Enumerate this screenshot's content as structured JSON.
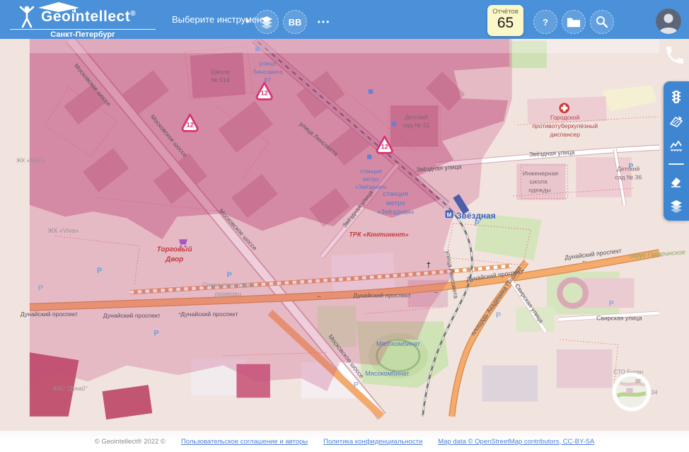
{
  "header": {
    "brand": "Geointellect",
    "brand_reg": "®",
    "city": "Санкт-Петербург",
    "tool_selector": {
      "label": "Выберите инструмент",
      "caret": "▼"
    },
    "bb_button": "BB",
    "more_button": "•••",
    "reports": {
      "label": "Отчётов",
      "count": "65"
    },
    "help_button": "?"
  },
  "side_panel": {
    "icons": [
      "traffic-light",
      "area-measure",
      "elevation-chart",
      "eraser",
      "layers-stack"
    ]
  },
  "map": {
    "streets": {
      "moskovskoe": "Московское шоссе",
      "lensoveta": "улица Ленсовета",
      "dunaysky": "Дунайский проспект",
      "zvezdnaya_ul": "Звёздная улица",
      "svirskaya": "Свирская улица",
      "pashina": "площадь Академика Пашина",
      "okrug": "округ Гагаринское"
    },
    "pois": {
      "school519": [
        "Школа",
        "№ 519"
      ],
      "address87": [
        "улица",
        "Ленсовета",
        "87"
      ],
      "detsad31": [
        "Детский",
        "сад № 31"
      ],
      "dispanser": [
        "Городской",
        "противотуберкулёзный",
        "диспансер"
      ],
      "school_odezhdy": [
        "Инженерная",
        "школа",
        "одежды"
      ],
      "detsad36": [
        "Детский",
        "сад № 36"
      ],
      "zhk_viva": "ЖК «Viva»",
      "zhk_neo": "ЖК «NEO»",
      "torgovy_dvor": [
        "Торговый",
        "Двор"
      ],
      "trk_kontinent": "ТРК «Континент»",
      "stroitelstvo": [
        "Строительство",
        "развязки"
      ],
      "myasokombinat": "Мясокомбинат",
      "kas_dunay": "КАС \"Дунай\"",
      "sto_buran": "СТО Буран",
      "russ34": "РУСС34"
    },
    "metro": {
      "station": "Звёздная",
      "m": "М",
      "entrance_lines": [
        "станция",
        "метро",
        "«Звёздная»"
      ]
    },
    "parking": "P",
    "church_cross": "†",
    "arrows": {
      "left": "←",
      "right": "→"
    },
    "markers": [
      {
        "value": "12"
      },
      {
        "value": "12"
      },
      {
        "value": "12"
      }
    ]
  },
  "footer": {
    "copyright": "© Geointellect® 2022 ©",
    "links": [
      "Пользовательское соглашение и авторы",
      "Политика конфиденциальности",
      "Map data © OpenStreetMap contributors, CC-BY-SA"
    ]
  },
  "colors": {
    "header_blue": "#4a91d9",
    "panel_blue": "#3e86d2",
    "badge_yellow": "#fbf7c8",
    "overlay_dark": "#b22a62",
    "overlay_mid": "#c75082",
    "link_blue": "#4a7fd4"
  }
}
